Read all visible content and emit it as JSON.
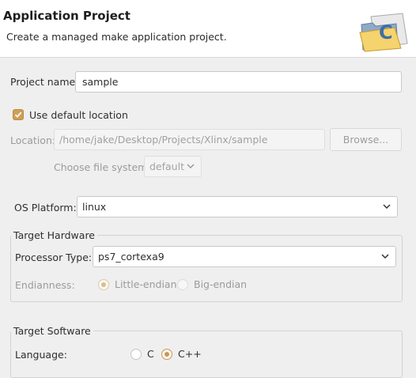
{
  "header": {
    "title": "Application Project",
    "description": "Create a managed make application project."
  },
  "project": {
    "name_label": "Project name:",
    "name_value": "sample",
    "use_default_label": "Use default location",
    "use_default_checked": true,
    "location_label": "Location:",
    "location_value": "/home/jake/Desktop/Projects/Xlinx/sample",
    "browse_label": "Browse...",
    "filesystem_label": "Choose file system:",
    "filesystem_value": "default"
  },
  "os": {
    "label": "OS Platform:",
    "value": "linux"
  },
  "target_hardware": {
    "title": "Target Hardware",
    "processor_label": "Processor Type:",
    "processor_value": "ps7_cortexa9",
    "endianness_label": "Endianness:",
    "endianness_options": [
      "Little-endian",
      "Big-endian"
    ],
    "endianness_selected": "Little-endian"
  },
  "target_software": {
    "title": "Target Software",
    "language_label": "Language:",
    "language_options": [
      "C",
      "C++"
    ],
    "language_selected": "C++"
  },
  "icons": [
    "wizard-folder-c-icon",
    "checkmark-icon",
    "chevron-down-icon"
  ],
  "colors": {
    "accent": "#cf9f57",
    "background": "#efefef",
    "header_background": "#ffffff"
  }
}
